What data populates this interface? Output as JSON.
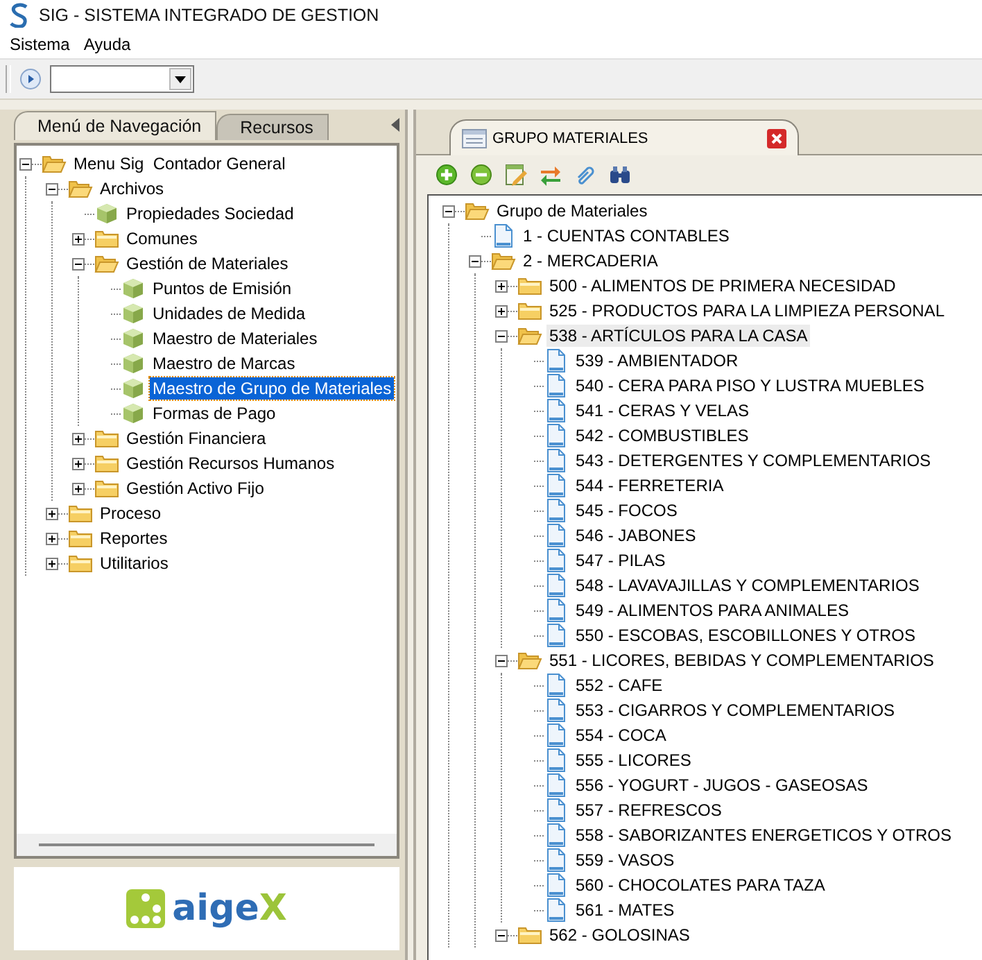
{
  "window": {
    "title": "SIG - SISTEMA INTEGRADO DE GESTION"
  },
  "menu": [
    "Sistema",
    "Ayuda"
  ],
  "left_tabs": [
    {
      "label": "Menú de Navegación",
      "selected": true
    },
    {
      "label": "Recursos",
      "selected": false
    }
  ],
  "nav_tree": [
    {
      "label": "Menu Sig  Contador General",
      "kind": "folder",
      "expanded": true,
      "selected": false,
      "children": [
        {
          "label": "Archivos",
          "kind": "folder",
          "expanded": true,
          "selected": false,
          "children": [
            {
              "label": "Propiedades Sociedad",
              "kind": "leaf",
              "selected": false
            },
            {
              "label": "Comunes",
              "kind": "folder",
              "expanded": false,
              "selected": false
            },
            {
              "label": "Gestión de Materiales",
              "kind": "folder",
              "expanded": true,
              "selected": false,
              "children": [
                {
                  "label": "Puntos de Emisión",
                  "kind": "leaf",
                  "selected": false
                },
                {
                  "label": "Unidades de Medida",
                  "kind": "leaf",
                  "selected": false
                },
                {
                  "label": "Maestro de Materiales",
                  "kind": "leaf",
                  "selected": false
                },
                {
                  "label": "Maestro de Marcas",
                  "kind": "leaf",
                  "selected": false
                },
                {
                  "label": "Maestro de Grupo de Materiales",
                  "kind": "leaf",
                  "selected": true
                },
                {
                  "label": "Formas de Pago",
                  "kind": "leaf",
                  "selected": false
                }
              ]
            },
            {
              "label": "Gestión Financiera",
              "kind": "folder",
              "expanded": false,
              "selected": false
            },
            {
              "label": "Gestión Recursos Humanos",
              "kind": "folder",
              "expanded": false,
              "selected": false
            },
            {
              "label": "Gestión Activo Fijo",
              "kind": "folder",
              "expanded": false,
              "selected": false
            }
          ]
        },
        {
          "label": "Proceso",
          "kind": "folder",
          "expanded": false,
          "selected": false
        },
        {
          "label": "Reportes",
          "kind": "folder",
          "expanded": false,
          "selected": false
        },
        {
          "label": "Utilitarios",
          "kind": "folder",
          "expanded": false,
          "selected": false
        }
      ]
    }
  ],
  "logo": {
    "main": "aige",
    "accent": "X"
  },
  "document_tab": {
    "title": "GRUPO MATERIALES"
  },
  "group_tree": [
    {
      "label": "Grupo de Materiales",
      "kind": "folder",
      "expanded": true,
      "selected": false,
      "children": [
        {
          "label": "1 - CUENTAS CONTABLES",
          "kind": "doc",
          "selected": false
        },
        {
          "label": "2 - MERCADERIA",
          "kind": "folder",
          "expanded": true,
          "selected": false,
          "children": [
            {
              "label": "500 - ALIMENTOS DE PRIMERA NECESIDAD",
              "kind": "folder",
              "expanded": false,
              "selected": false
            },
            {
              "label": "525 - PRODUCTOS PARA LA LIMPIEZA PERSONAL",
              "kind": "folder",
              "expanded": false,
              "selected": false
            },
            {
              "label": "538 - ARTÍCULOS PARA LA CASA",
              "kind": "folder",
              "expanded": true,
              "selected": true,
              "children": [
                {
                  "label": "539 - AMBIENTADOR",
                  "kind": "doc",
                  "selected": false
                },
                {
                  "label": "540 - CERA PARA PISO Y LUSTRA MUEBLES",
                  "kind": "doc",
                  "selected": false
                },
                {
                  "label": "541 - CERAS Y VELAS",
                  "kind": "doc",
                  "selected": false
                },
                {
                  "label": "542 - COMBUSTIBLES",
                  "kind": "doc",
                  "selected": false
                },
                {
                  "label": "543 - DETERGENTES Y COMPLEMENTARIOS",
                  "kind": "doc",
                  "selected": false
                },
                {
                  "label": "544 - FERRETERIA",
                  "kind": "doc",
                  "selected": false
                },
                {
                  "label": "545 - FOCOS",
                  "kind": "doc",
                  "selected": false
                },
                {
                  "label": "546 - JABONES",
                  "kind": "doc",
                  "selected": false
                },
                {
                  "label": "547 - PILAS",
                  "kind": "doc",
                  "selected": false
                },
                {
                  "label": "548 - LAVAVAJILLAS Y COMPLEMENTARIOS",
                  "kind": "doc",
                  "selected": false
                },
                {
                  "label": "549 - ALIMENTOS PARA ANIMALES",
                  "kind": "doc",
                  "selected": false
                },
                {
                  "label": "550 - ESCOBAS, ESCOBILLONES Y OTROS",
                  "kind": "doc",
                  "selected": false
                }
              ]
            },
            {
              "label": "551 - LICORES, BEBIDAS Y COMPLEMENTARIOS",
              "kind": "folder",
              "expanded": true,
              "selected": false,
              "children": [
                {
                  "label": "552 - CAFE",
                  "kind": "doc",
                  "selected": false
                },
                {
                  "label": "553 - CIGARROS Y COMPLEMENTARIOS",
                  "kind": "doc",
                  "selected": false
                },
                {
                  "label": "554 - COCA",
                  "kind": "doc",
                  "selected": false
                },
                {
                  "label": "555 - LICORES",
                  "kind": "doc",
                  "selected": false
                },
                {
                  "label": "556 - YOGURT - JUGOS - GASEOSAS",
                  "kind": "doc",
                  "selected": false
                },
                {
                  "label": "557 - REFRESCOS",
                  "kind": "doc",
                  "selected": false
                },
                {
                  "label": "558 - SABORIZANTES ENERGETICOS Y OTROS",
                  "kind": "doc",
                  "selected": false
                },
                {
                  "label": "559 - VASOS",
                  "kind": "doc",
                  "selected": false
                },
                {
                  "label": "560 - CHOCOLATES PARA TAZA",
                  "kind": "doc",
                  "selected": false
                },
                {
                  "label": "561 - MATES",
                  "kind": "doc",
                  "selected": false
                }
              ]
            },
            {
              "label": "562 - GOLOSINAS",
              "kind": "folder",
              "expanded": true,
              "selected": false
            }
          ]
        }
      ]
    }
  ]
}
